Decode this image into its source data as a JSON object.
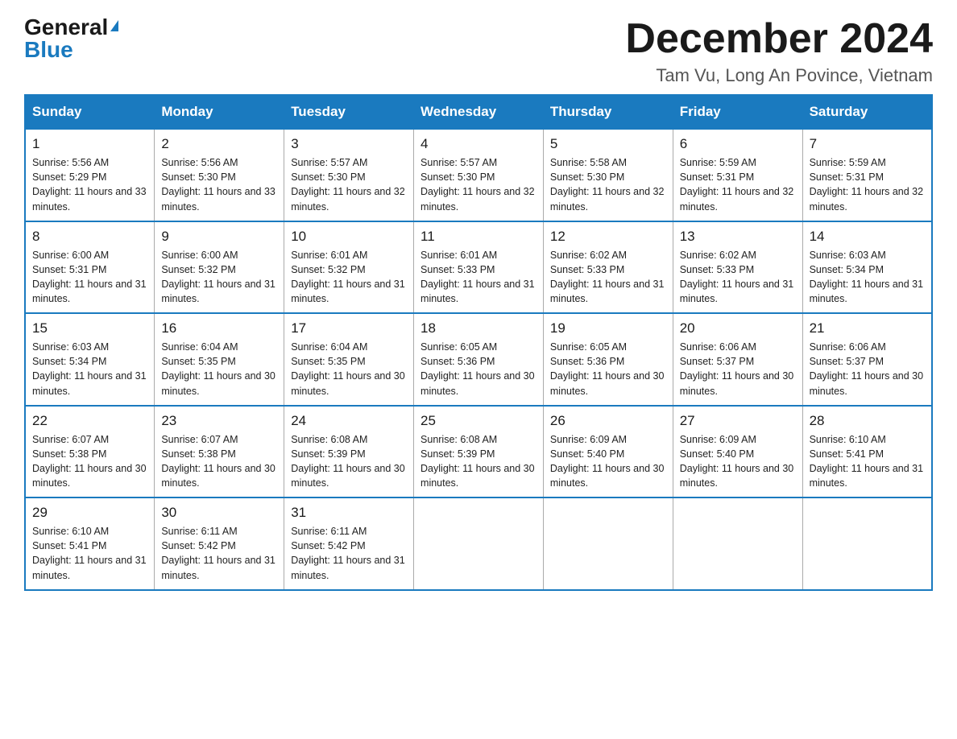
{
  "header": {
    "logo_general": "General",
    "logo_blue": "Blue",
    "month_title": "December 2024",
    "location": "Tam Vu, Long An Povince, Vietnam"
  },
  "days_of_week": [
    "Sunday",
    "Monday",
    "Tuesday",
    "Wednesday",
    "Thursday",
    "Friday",
    "Saturday"
  ],
  "weeks": [
    [
      {
        "day": "1",
        "sunrise": "5:56 AM",
        "sunset": "5:29 PM",
        "daylight": "11 hours and 33 minutes."
      },
      {
        "day": "2",
        "sunrise": "5:56 AM",
        "sunset": "5:30 PM",
        "daylight": "11 hours and 33 minutes."
      },
      {
        "day": "3",
        "sunrise": "5:57 AM",
        "sunset": "5:30 PM",
        "daylight": "11 hours and 32 minutes."
      },
      {
        "day": "4",
        "sunrise": "5:57 AM",
        "sunset": "5:30 PM",
        "daylight": "11 hours and 32 minutes."
      },
      {
        "day": "5",
        "sunrise": "5:58 AM",
        "sunset": "5:30 PM",
        "daylight": "11 hours and 32 minutes."
      },
      {
        "day": "6",
        "sunrise": "5:59 AM",
        "sunset": "5:31 PM",
        "daylight": "11 hours and 32 minutes."
      },
      {
        "day": "7",
        "sunrise": "5:59 AM",
        "sunset": "5:31 PM",
        "daylight": "11 hours and 32 minutes."
      }
    ],
    [
      {
        "day": "8",
        "sunrise": "6:00 AM",
        "sunset": "5:31 PM",
        "daylight": "11 hours and 31 minutes."
      },
      {
        "day": "9",
        "sunrise": "6:00 AM",
        "sunset": "5:32 PM",
        "daylight": "11 hours and 31 minutes."
      },
      {
        "day": "10",
        "sunrise": "6:01 AM",
        "sunset": "5:32 PM",
        "daylight": "11 hours and 31 minutes."
      },
      {
        "day": "11",
        "sunrise": "6:01 AM",
        "sunset": "5:33 PM",
        "daylight": "11 hours and 31 minutes."
      },
      {
        "day": "12",
        "sunrise": "6:02 AM",
        "sunset": "5:33 PM",
        "daylight": "11 hours and 31 minutes."
      },
      {
        "day": "13",
        "sunrise": "6:02 AM",
        "sunset": "5:33 PM",
        "daylight": "11 hours and 31 minutes."
      },
      {
        "day": "14",
        "sunrise": "6:03 AM",
        "sunset": "5:34 PM",
        "daylight": "11 hours and 31 minutes."
      }
    ],
    [
      {
        "day": "15",
        "sunrise": "6:03 AM",
        "sunset": "5:34 PM",
        "daylight": "11 hours and 31 minutes."
      },
      {
        "day": "16",
        "sunrise": "6:04 AM",
        "sunset": "5:35 PM",
        "daylight": "11 hours and 30 minutes."
      },
      {
        "day": "17",
        "sunrise": "6:04 AM",
        "sunset": "5:35 PM",
        "daylight": "11 hours and 30 minutes."
      },
      {
        "day": "18",
        "sunrise": "6:05 AM",
        "sunset": "5:36 PM",
        "daylight": "11 hours and 30 minutes."
      },
      {
        "day": "19",
        "sunrise": "6:05 AM",
        "sunset": "5:36 PM",
        "daylight": "11 hours and 30 minutes."
      },
      {
        "day": "20",
        "sunrise": "6:06 AM",
        "sunset": "5:37 PM",
        "daylight": "11 hours and 30 minutes."
      },
      {
        "day": "21",
        "sunrise": "6:06 AM",
        "sunset": "5:37 PM",
        "daylight": "11 hours and 30 minutes."
      }
    ],
    [
      {
        "day": "22",
        "sunrise": "6:07 AM",
        "sunset": "5:38 PM",
        "daylight": "11 hours and 30 minutes."
      },
      {
        "day": "23",
        "sunrise": "6:07 AM",
        "sunset": "5:38 PM",
        "daylight": "11 hours and 30 minutes."
      },
      {
        "day": "24",
        "sunrise": "6:08 AM",
        "sunset": "5:39 PM",
        "daylight": "11 hours and 30 minutes."
      },
      {
        "day": "25",
        "sunrise": "6:08 AM",
        "sunset": "5:39 PM",
        "daylight": "11 hours and 30 minutes."
      },
      {
        "day": "26",
        "sunrise": "6:09 AM",
        "sunset": "5:40 PM",
        "daylight": "11 hours and 30 minutes."
      },
      {
        "day": "27",
        "sunrise": "6:09 AM",
        "sunset": "5:40 PM",
        "daylight": "11 hours and 30 minutes."
      },
      {
        "day": "28",
        "sunrise": "6:10 AM",
        "sunset": "5:41 PM",
        "daylight": "11 hours and 31 minutes."
      }
    ],
    [
      {
        "day": "29",
        "sunrise": "6:10 AM",
        "sunset": "5:41 PM",
        "daylight": "11 hours and 31 minutes."
      },
      {
        "day": "30",
        "sunrise": "6:11 AM",
        "sunset": "5:42 PM",
        "daylight": "11 hours and 31 minutes."
      },
      {
        "day": "31",
        "sunrise": "6:11 AM",
        "sunset": "5:42 PM",
        "daylight": "11 hours and 31 minutes."
      },
      null,
      null,
      null,
      null
    ]
  ]
}
